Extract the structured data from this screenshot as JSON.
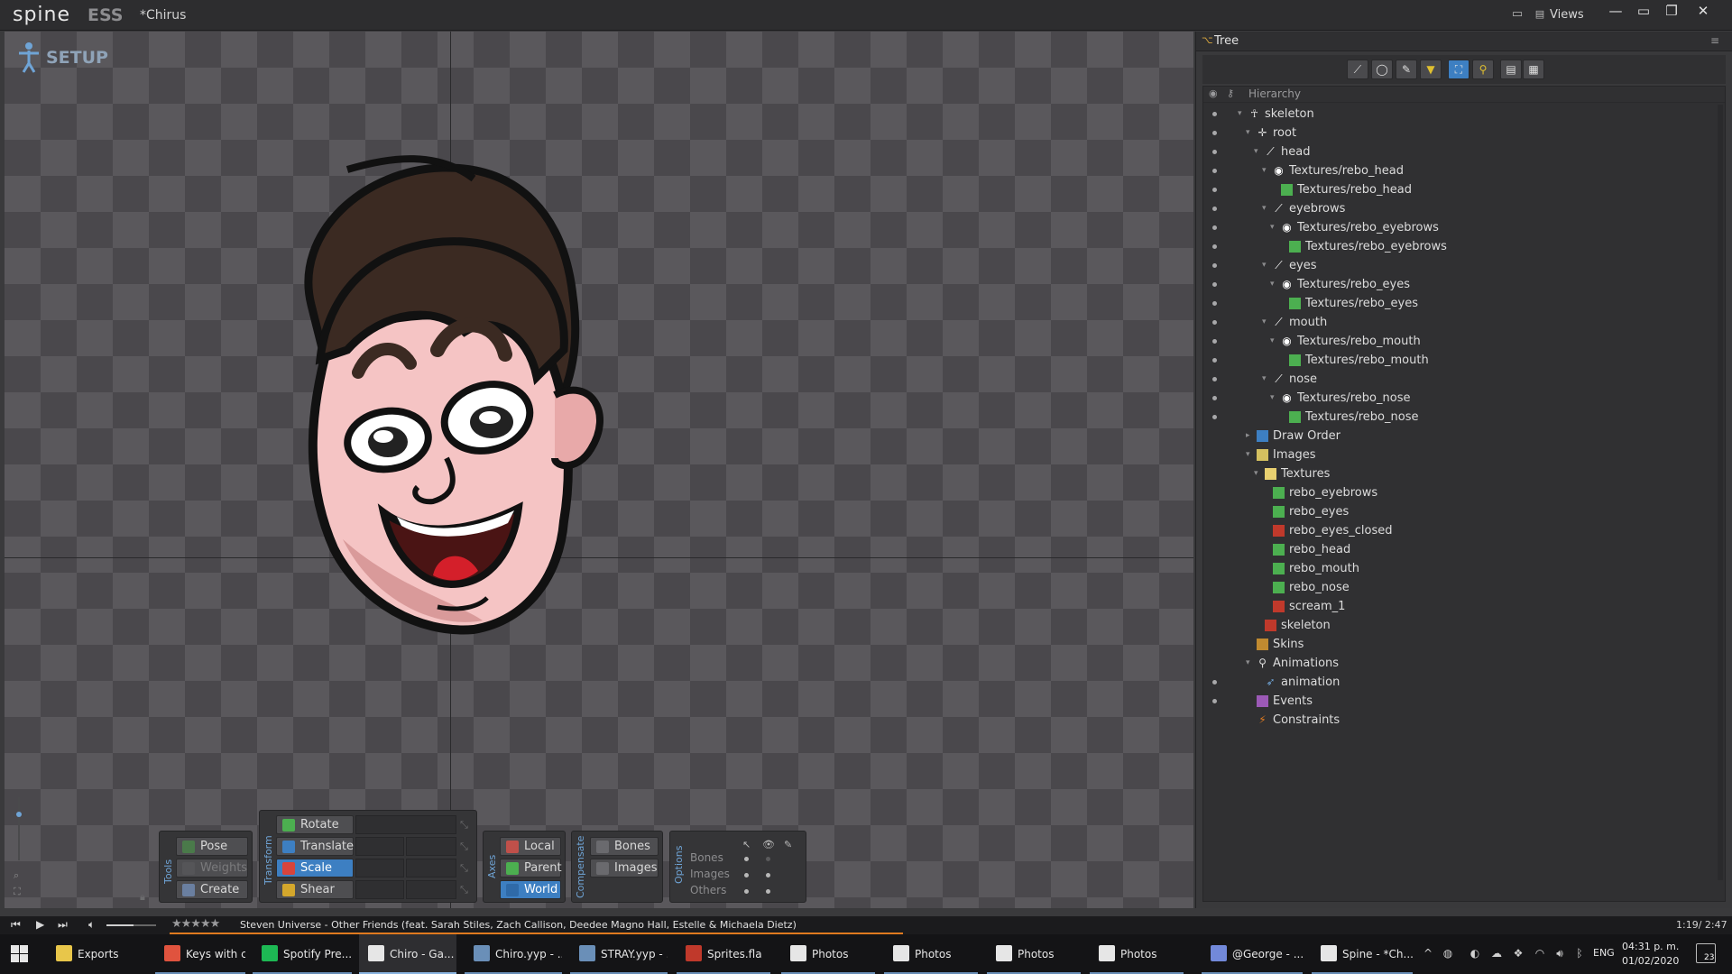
{
  "app": {
    "logo": "spine",
    "edition": "ESS",
    "project": "*Chirus",
    "views_label": "Views"
  },
  "viewport": {
    "mode_label": "SETUP"
  },
  "tools": {
    "group_label": "Tools",
    "pose": "Pose",
    "weights": "Weights",
    "create": "Create"
  },
  "transform": {
    "group_label": "Transform",
    "rotate": "Rotate",
    "translate": "Translate",
    "scale": "Scale",
    "shear": "Shear"
  },
  "axes": {
    "group_label": "Axes",
    "local": "Local",
    "parent": "Parent",
    "world": "World"
  },
  "compensate": {
    "group_label": "Compensate",
    "bones": "Bones",
    "images": "Images"
  },
  "options": {
    "group_label": "Options",
    "bones": "Bones",
    "images": "Images",
    "others": "Others"
  },
  "tree": {
    "tab_label": "Tree",
    "header": "Hierarchy",
    "rows": [
      {
        "label": "skeleton",
        "icon": "skeleton-icon"
      },
      {
        "label": "root",
        "icon": "root-bone-icon"
      },
      {
        "label": "head",
        "icon": "bone-icon"
      },
      {
        "label": "Textures/rebo_head",
        "icon": "slot-icon"
      },
      {
        "label": "Textures/rebo_head",
        "icon": "attachment-icon"
      },
      {
        "label": "eyebrows",
        "icon": "bone-icon"
      },
      {
        "label": "Textures/rebo_eyebrows",
        "icon": "slot-icon"
      },
      {
        "label": "Textures/rebo_eyebrows",
        "icon": "attachment-icon"
      },
      {
        "label": "eyes",
        "icon": "bone-icon"
      },
      {
        "label": "Textures/rebo_eyes",
        "icon": "slot-icon"
      },
      {
        "label": "Textures/rebo_eyes",
        "icon": "attachment-icon"
      },
      {
        "label": "mouth",
        "icon": "bone-icon"
      },
      {
        "label": "Textures/rebo_mouth",
        "icon": "slot-icon"
      },
      {
        "label": "Textures/rebo_mouth",
        "icon": "attachment-icon"
      },
      {
        "label": "nose",
        "icon": "bone-icon"
      },
      {
        "label": "Textures/rebo_nose",
        "icon": "slot-icon"
      },
      {
        "label": "Textures/rebo_nose",
        "icon": "attachment-icon"
      },
      {
        "label": "Draw Order",
        "icon": "draw-order-icon"
      },
      {
        "label": "Images",
        "icon": "images-folder-icon"
      },
      {
        "label": "Textures",
        "icon": "folder-icon"
      },
      {
        "label": "rebo_eyebrows",
        "icon": "image-icon"
      },
      {
        "label": "rebo_eyes",
        "icon": "image-icon"
      },
      {
        "label": "rebo_eyes_closed",
        "icon": "unused-image-icon"
      },
      {
        "label": "rebo_head",
        "icon": "image-icon"
      },
      {
        "label": "rebo_mouth",
        "icon": "image-icon"
      },
      {
        "label": "rebo_nose",
        "icon": "image-icon"
      },
      {
        "label": "scream_1",
        "icon": "unused-image-icon"
      },
      {
        "label": "skeleton",
        "icon": "unused-image-icon"
      },
      {
        "label": "Skins",
        "icon": "skins-icon"
      },
      {
        "label": "Animations",
        "icon": "animations-icon"
      },
      {
        "label": "animation",
        "icon": "animation-icon"
      },
      {
        "label": "Events",
        "icon": "events-icon"
      },
      {
        "label": "Constraints",
        "icon": "constraints-icon"
      }
    ]
  },
  "player": {
    "song": "Steven Universe - Other Friends (feat. Sarah Stiles, Zach Callison, Deedee Magno Hall, Estelle & Michaela Dietz)",
    "time": "1:19/ 2:47",
    "progress": 0.47
  },
  "taskbar": {
    "items": [
      {
        "label": "Exports",
        "icon": "folder-icon"
      },
      {
        "label": "Keys with c...",
        "icon": "chrome-icon"
      },
      {
        "label": "Spotify Pre...",
        "icon": "spotify-icon"
      },
      {
        "label": "Chiro - Ga...",
        "icon": "unity-icon"
      },
      {
        "label": "Chiro.yyp - ...",
        "icon": "gamemaker-icon"
      },
      {
        "label": "STRAY.yyp - ...",
        "icon": "gamemaker-icon"
      },
      {
        "label": "Sprites.fla",
        "icon": "flash-icon"
      },
      {
        "label": "Photos",
        "icon": "photos-icon"
      },
      {
        "label": "Photos",
        "icon": "photos-icon"
      },
      {
        "label": "Photos",
        "icon": "photos-icon"
      },
      {
        "label": "Photos",
        "icon": "photos-icon"
      },
      {
        "label": "@George - ...",
        "icon": "discord-icon"
      },
      {
        "label": "Spine - *Ch...",
        "icon": "spine-icon"
      }
    ],
    "lang": "ENG",
    "time": "04:31 p. m.",
    "date": "01/02/2020",
    "notifications": "23"
  },
  "colors": {
    "accent": "#3d7fc2",
    "progress": "#e07a1f",
    "bone": "#ffffff",
    "image_ok": "#4caf50",
    "image_unused": "#c0392b"
  }
}
